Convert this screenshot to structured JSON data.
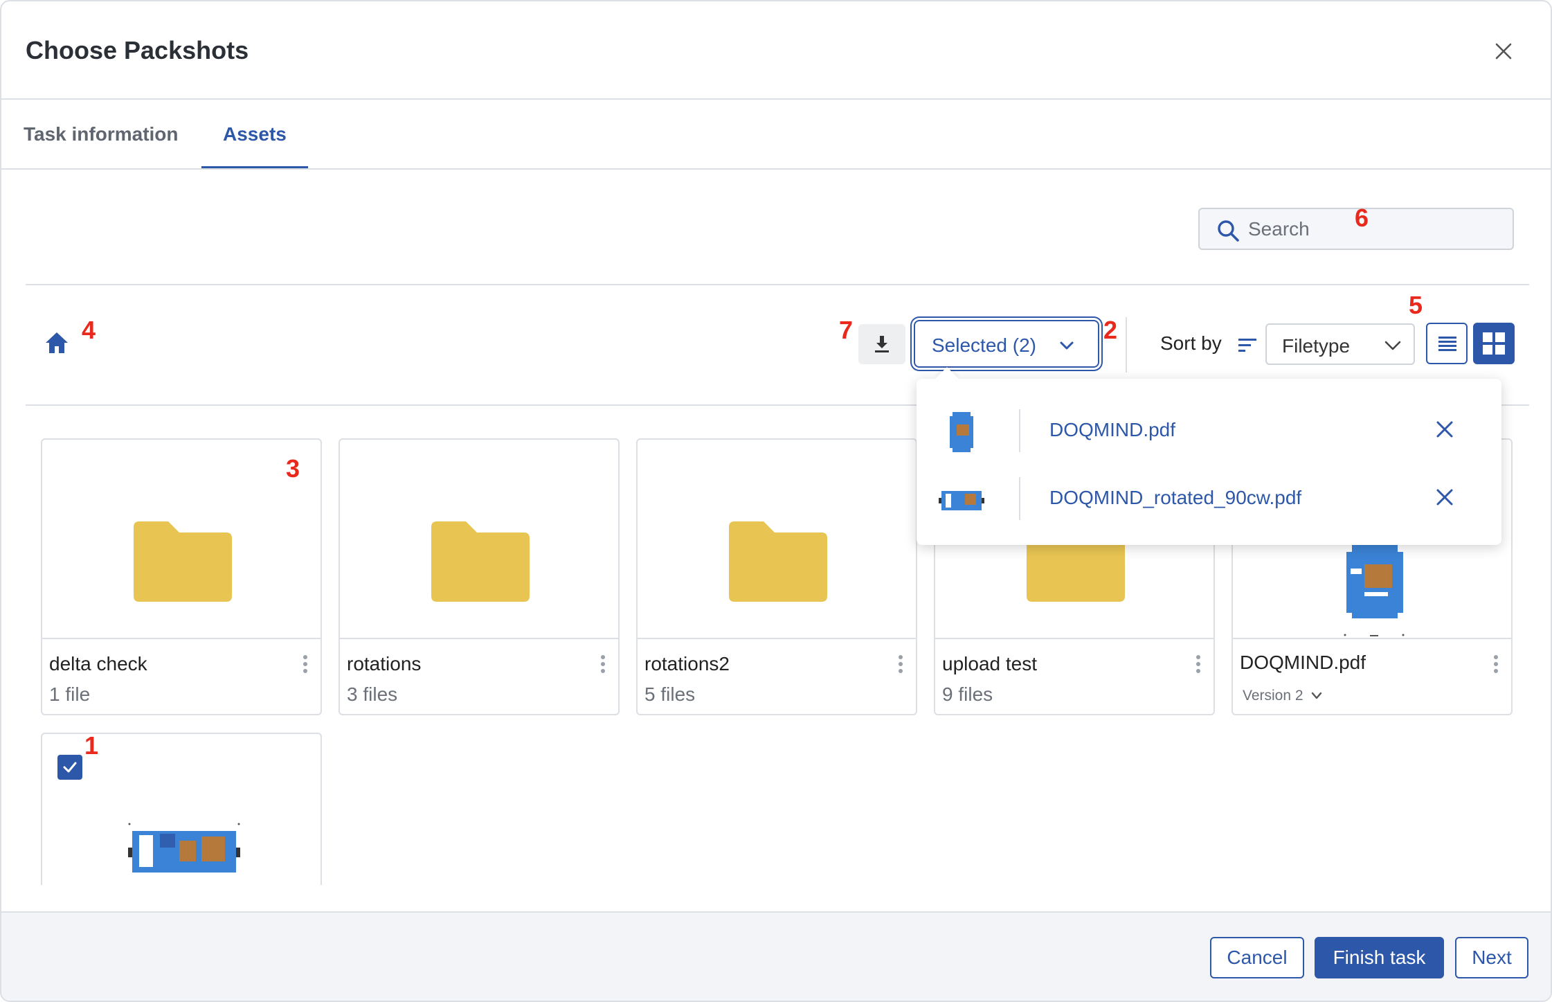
{
  "dialog": {
    "title": "Choose Packshots"
  },
  "tabs": [
    {
      "label": "Task information"
    },
    {
      "label": "Assets"
    }
  ],
  "search": {
    "placeholder": "Search"
  },
  "toolbar": {
    "selected_label": "Selected (2)",
    "sort_label": "Sort by",
    "sort_value": "Filetype"
  },
  "annotations": [
    "1",
    "2",
    "3",
    "4",
    "5",
    "6",
    "7"
  ],
  "folders": [
    {
      "name": "delta check",
      "count": "1 file"
    },
    {
      "name": "rotations",
      "count": "3 files"
    },
    {
      "name": "rotations2",
      "count": "5 files"
    },
    {
      "name": "upload test",
      "count": "9 files"
    }
  ],
  "file_card": {
    "name": "DOQMIND.pdf",
    "version": "Version 2"
  },
  "selected_files": [
    {
      "name": "DOQMIND.pdf"
    },
    {
      "name": "DOQMIND_rotated_90cw.pdf"
    }
  ],
  "footer": {
    "cancel": "Cancel",
    "finish": "Finish task",
    "next": "Next"
  },
  "colors": {
    "accent": "#2d57a8",
    "folder": "#e8c553",
    "annotation": "#e8291c"
  }
}
